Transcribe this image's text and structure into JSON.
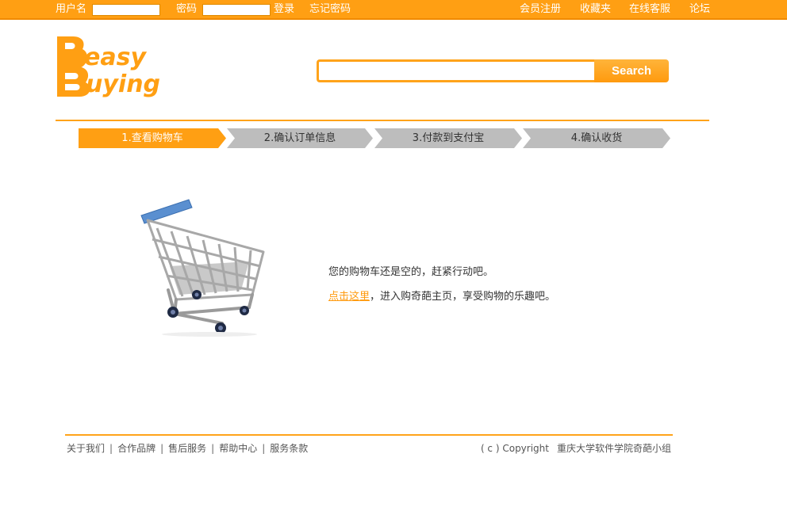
{
  "topbar": {
    "username_label": "用户名",
    "username_value": "",
    "password_label": "密码",
    "password_value": "",
    "login": "登录",
    "forgot_password": "忘记密码",
    "register": "会员注册",
    "favorites": "收藏夹",
    "customer_service": "在线客服",
    "forum": "论坛"
  },
  "brand": {
    "logo_text_line1": "easy",
    "logo_text_line2": "uying",
    "logo_initial": "B",
    "logo_color": "#ff9f13"
  },
  "search": {
    "value": "",
    "button_label": "Search"
  },
  "steps": [
    {
      "label": "1.查看购物车",
      "active": true
    },
    {
      "label": "2.确认订单信息",
      "active": false
    },
    {
      "label": "3.付款到支付宝",
      "active": false
    },
    {
      "label": "4.确认收货",
      "active": false
    }
  ],
  "cart_empty": {
    "message": "您的购物车还是空的，赶紧行动吧。",
    "link_text": "点击这里",
    "after_link": "，进入购奇葩主页，享受购物的乐趣吧。"
  },
  "footer": {
    "links": [
      "关于我们",
      "合作品牌",
      "售后服务",
      "帮助中心",
      "服务条款"
    ],
    "copyright": "( c ) Copyright",
    "owner": "重庆大学软件学院奇葩小组"
  },
  "colors": {
    "accent": "#ff9f13",
    "step_inactive": "#bdbdbd",
    "link": "#ff9a0e"
  }
}
